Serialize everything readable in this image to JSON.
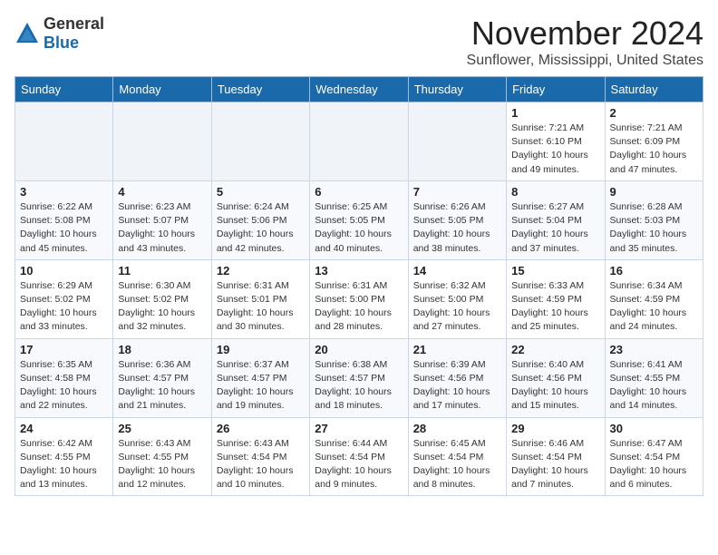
{
  "header": {
    "logo_general": "General",
    "logo_blue": "Blue",
    "month_title": "November 2024",
    "location": "Sunflower, Mississippi, United States"
  },
  "weekdays": [
    "Sunday",
    "Monday",
    "Tuesday",
    "Wednesday",
    "Thursday",
    "Friday",
    "Saturday"
  ],
  "weeks": [
    [
      {
        "day": "",
        "detail": ""
      },
      {
        "day": "",
        "detail": ""
      },
      {
        "day": "",
        "detail": ""
      },
      {
        "day": "",
        "detail": ""
      },
      {
        "day": "",
        "detail": ""
      },
      {
        "day": "1",
        "detail": "Sunrise: 7:21 AM\nSunset: 6:10 PM\nDaylight: 10 hours\nand 49 minutes."
      },
      {
        "day": "2",
        "detail": "Sunrise: 7:21 AM\nSunset: 6:09 PM\nDaylight: 10 hours\nand 47 minutes."
      }
    ],
    [
      {
        "day": "3",
        "detail": "Sunrise: 6:22 AM\nSunset: 5:08 PM\nDaylight: 10 hours\nand 45 minutes."
      },
      {
        "day": "4",
        "detail": "Sunrise: 6:23 AM\nSunset: 5:07 PM\nDaylight: 10 hours\nand 43 minutes."
      },
      {
        "day": "5",
        "detail": "Sunrise: 6:24 AM\nSunset: 5:06 PM\nDaylight: 10 hours\nand 42 minutes."
      },
      {
        "day": "6",
        "detail": "Sunrise: 6:25 AM\nSunset: 5:05 PM\nDaylight: 10 hours\nand 40 minutes."
      },
      {
        "day": "7",
        "detail": "Sunrise: 6:26 AM\nSunset: 5:05 PM\nDaylight: 10 hours\nand 38 minutes."
      },
      {
        "day": "8",
        "detail": "Sunrise: 6:27 AM\nSunset: 5:04 PM\nDaylight: 10 hours\nand 37 minutes."
      },
      {
        "day": "9",
        "detail": "Sunrise: 6:28 AM\nSunset: 5:03 PM\nDaylight: 10 hours\nand 35 minutes."
      }
    ],
    [
      {
        "day": "10",
        "detail": "Sunrise: 6:29 AM\nSunset: 5:02 PM\nDaylight: 10 hours\nand 33 minutes."
      },
      {
        "day": "11",
        "detail": "Sunrise: 6:30 AM\nSunset: 5:02 PM\nDaylight: 10 hours\nand 32 minutes."
      },
      {
        "day": "12",
        "detail": "Sunrise: 6:31 AM\nSunset: 5:01 PM\nDaylight: 10 hours\nand 30 minutes."
      },
      {
        "day": "13",
        "detail": "Sunrise: 6:31 AM\nSunset: 5:00 PM\nDaylight: 10 hours\nand 28 minutes."
      },
      {
        "day": "14",
        "detail": "Sunrise: 6:32 AM\nSunset: 5:00 PM\nDaylight: 10 hours\nand 27 minutes."
      },
      {
        "day": "15",
        "detail": "Sunrise: 6:33 AM\nSunset: 4:59 PM\nDaylight: 10 hours\nand 25 minutes."
      },
      {
        "day": "16",
        "detail": "Sunrise: 6:34 AM\nSunset: 4:59 PM\nDaylight: 10 hours\nand 24 minutes."
      }
    ],
    [
      {
        "day": "17",
        "detail": "Sunrise: 6:35 AM\nSunset: 4:58 PM\nDaylight: 10 hours\nand 22 minutes."
      },
      {
        "day": "18",
        "detail": "Sunrise: 6:36 AM\nSunset: 4:57 PM\nDaylight: 10 hours\nand 21 minutes."
      },
      {
        "day": "19",
        "detail": "Sunrise: 6:37 AM\nSunset: 4:57 PM\nDaylight: 10 hours\nand 19 minutes."
      },
      {
        "day": "20",
        "detail": "Sunrise: 6:38 AM\nSunset: 4:57 PM\nDaylight: 10 hours\nand 18 minutes."
      },
      {
        "day": "21",
        "detail": "Sunrise: 6:39 AM\nSunset: 4:56 PM\nDaylight: 10 hours\nand 17 minutes."
      },
      {
        "day": "22",
        "detail": "Sunrise: 6:40 AM\nSunset: 4:56 PM\nDaylight: 10 hours\nand 15 minutes."
      },
      {
        "day": "23",
        "detail": "Sunrise: 6:41 AM\nSunset: 4:55 PM\nDaylight: 10 hours\nand 14 minutes."
      }
    ],
    [
      {
        "day": "24",
        "detail": "Sunrise: 6:42 AM\nSunset: 4:55 PM\nDaylight: 10 hours\nand 13 minutes."
      },
      {
        "day": "25",
        "detail": "Sunrise: 6:43 AM\nSunset: 4:55 PM\nDaylight: 10 hours\nand 12 minutes."
      },
      {
        "day": "26",
        "detail": "Sunrise: 6:43 AM\nSunset: 4:54 PM\nDaylight: 10 hours\nand 10 minutes."
      },
      {
        "day": "27",
        "detail": "Sunrise: 6:44 AM\nSunset: 4:54 PM\nDaylight: 10 hours\nand 9 minutes."
      },
      {
        "day": "28",
        "detail": "Sunrise: 6:45 AM\nSunset: 4:54 PM\nDaylight: 10 hours\nand 8 minutes."
      },
      {
        "day": "29",
        "detail": "Sunrise: 6:46 AM\nSunset: 4:54 PM\nDaylight: 10 hours\nand 7 minutes."
      },
      {
        "day": "30",
        "detail": "Sunrise: 6:47 AM\nSunset: 4:54 PM\nDaylight: 10 hours\nand 6 minutes."
      }
    ]
  ]
}
